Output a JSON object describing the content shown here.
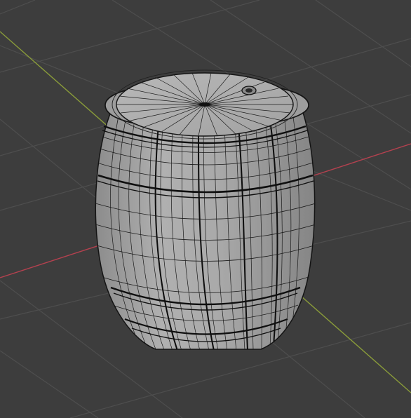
{
  "viewport": {
    "background_color": "#3d3d3d",
    "grid_color": "#4e4e4e",
    "x_axis_color": "#b4414f",
    "y_axis_color": "#8a9c3a",
    "mesh_fill_color": "#a9a9a9",
    "mesh_wire_color": "#141414"
  },
  "object": {
    "kind": "barrel",
    "display": "wireframe-on-solid",
    "features": [
      "staves",
      "metal-hoops",
      "lid",
      "bung-hole"
    ]
  }
}
